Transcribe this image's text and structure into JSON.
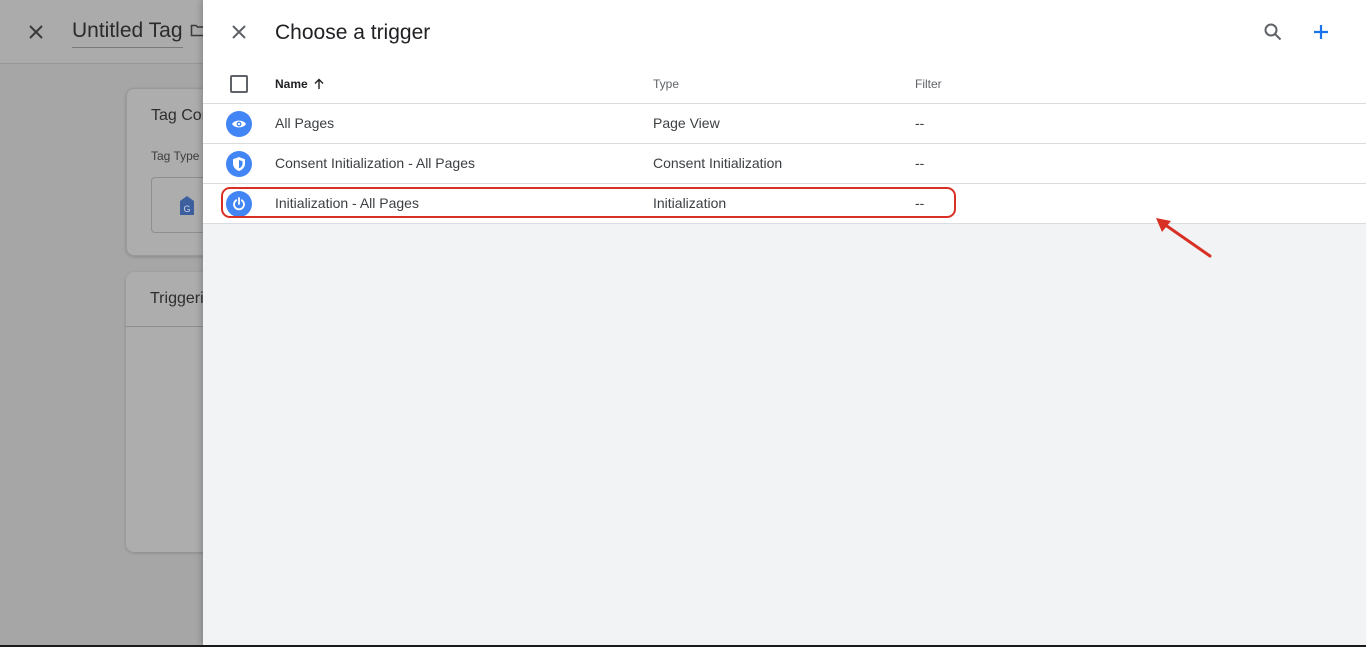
{
  "background": {
    "tag_title": "Untitled Tag",
    "card1_title": "Tag Con",
    "card1_sub": "Tag Type",
    "card2_title": "Triggeri",
    "close_icon": "close-icon",
    "folder_icon": "folder-icon"
  },
  "panel": {
    "title": "Choose a trigger",
    "search_icon": "search-icon",
    "add_icon": "plus-icon",
    "accent_color": "#1a73e8",
    "columns": {
      "name": "Name",
      "type": "Type",
      "filter": "Filter"
    },
    "rows": [
      {
        "icon": "eye-icon",
        "name": "All Pages",
        "type": "Page View",
        "filter": "--"
      },
      {
        "icon": "shield-icon",
        "name": "Consent Initialization - All Pages",
        "type": "Consent Initialization",
        "filter": "--"
      },
      {
        "icon": "power-icon",
        "name": "Initialization - All Pages",
        "type": "Initialization",
        "filter": "--"
      }
    ],
    "icon_color": "#4285f4",
    "highlight_color": "#d93025"
  }
}
